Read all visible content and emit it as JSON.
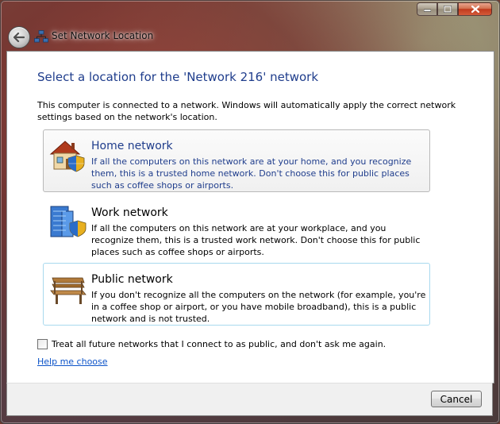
{
  "window": {
    "title": "Set Network Location",
    "caption_buttons": [
      "minimize",
      "maximize",
      "close"
    ]
  },
  "heading": "Select a location for the 'Network  216' network",
  "intro": "This computer is connected to a network. Windows will automatically apply the correct network settings based on the network's location.",
  "options": [
    {
      "title": "Home network",
      "description": "If all the computers on this network are at your home, and you recognize them, this is a trusted home network.  Don't choose this for public places such as coffee shops or airports.",
      "icon": "house-shield-icon"
    },
    {
      "title": "Work network",
      "description": "If all the computers on this network are at your workplace, and you recognize them, this is a trusted work network.  Don't choose this for public places such as coffee shops or airports.",
      "icon": "office-building-shield-icon"
    },
    {
      "title": "Public network",
      "description": "If you don't recognize all the computers on the network (for example, you're in a coffee shop or airport, or you have mobile broadband), this is a public network and is not trusted.",
      "icon": "park-bench-icon"
    }
  ],
  "checkbox": {
    "label": "Treat all future networks that I connect to as public, and don't ask me again.",
    "checked": false
  },
  "help_link": "Help me choose",
  "cancel_label": "Cancel",
  "colors": {
    "heading": "#1f3d8c",
    "link": "#0d54c9",
    "highlight_border": "#a8d9ee"
  }
}
